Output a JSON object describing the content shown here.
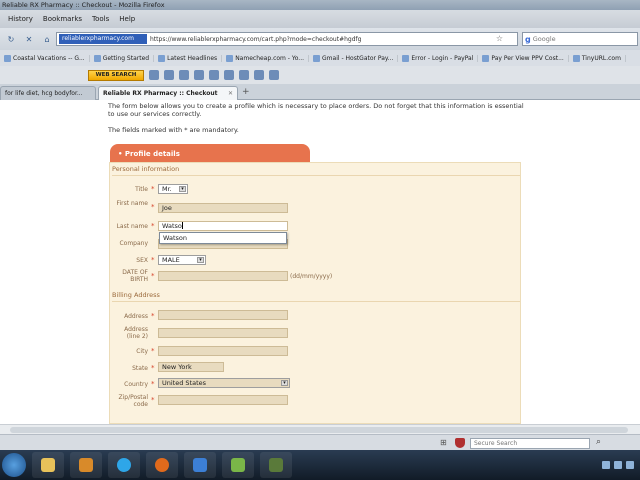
{
  "window": {
    "title": "Reliable RX Pharmacy :: Checkout - Mozilla Firefox"
  },
  "menu": [
    "History",
    "Bookmarks",
    "Tools",
    "Help"
  ],
  "nav": {
    "url_domain": "reliablerxpharmacy.com",
    "url_path": "https://www.reliablerxpharmacy.com/cart.php?mode=checkout#hgdfg",
    "search_placeholder": "Google"
  },
  "bookmarks": [
    "Coastal Vacations -- G...",
    "Getting Started",
    "Latest Headlines",
    "Namecheap.com - Yo...",
    "Gmail - HostGator Pay...",
    "Error - Login - PayPal",
    "Pay Per View PPV Cost...",
    "TinyURL.com"
  ],
  "toolbar": {
    "websearch_label": "WEB SEARCH"
  },
  "tabs": [
    {
      "label": "for life diet, hcg bodyfor..."
    },
    {
      "label": "Reliable RX Pharmacy :: Checkout"
    }
  ],
  "page": {
    "intro": "The form below allows you to create a profile which is necessary to place orders. Do not forget that this information is essential to use our services correctly.",
    "mandatory_note": "The fields marked with * are mandatory.",
    "profile_title": "• Profile details",
    "personal_section": "Personal information",
    "billing_section": "Billing Address",
    "fields": {
      "title": {
        "label": "Title",
        "value": "Mr."
      },
      "first_name": {
        "label": "First name",
        "value": "Joe"
      },
      "last_name": {
        "label": "Last name",
        "value": "Watso"
      },
      "company": {
        "label": "Company",
        "value": ""
      },
      "sex": {
        "label": "SEX",
        "value": "MALE"
      },
      "dob": {
        "label": "DATE OF BIRTH",
        "value": "",
        "hint": "(dd/mm/yyyy)"
      },
      "address": {
        "label": "Address",
        "value": ""
      },
      "address2": {
        "label": "Address (line 2)",
        "value": ""
      },
      "city": {
        "label": "City",
        "value": ""
      },
      "state": {
        "label": "State",
        "value": "New York"
      },
      "country": {
        "label": "Country",
        "value": "United States"
      },
      "zip": {
        "label": "Zip/Postal code",
        "value": ""
      }
    },
    "autocomplete_suggestion": "Watson"
  },
  "status": {
    "search_placeholder": "Secure Search"
  }
}
